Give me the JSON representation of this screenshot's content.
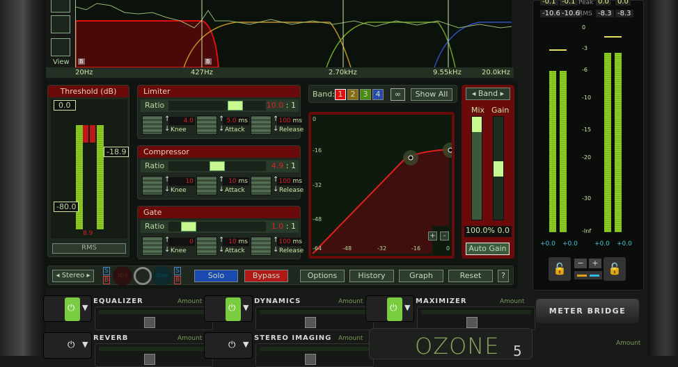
{
  "spectrum": {
    "view_label": "View",
    "freq_labels": [
      "20Hz",
      "427Hz",
      "2.70kHz",
      "9.55kHz",
      "20.0kHz"
    ],
    "band_marker": "B"
  },
  "threshold": {
    "title": "Threshold (dB)",
    "top": "0.0",
    "mid": "-18.9",
    "bottom": "-80.0",
    "readout": "8.9",
    "mode": "RMS"
  },
  "limiter": {
    "title": "Limiter",
    "ratio_label": "Ratio",
    "ratio": "10.0",
    "ratio_suffix": ": 1",
    "knee": "4.0",
    "attack": "5.0",
    "release": "100",
    "ms": "ms",
    "knee_label": "Knee",
    "attack_label": "Attack",
    "release_label": "Release",
    "ratio_pos": 0.72
  },
  "compressor": {
    "title": "Compressor",
    "ratio_label": "Ratio",
    "ratio": "4.9",
    "ratio_suffix": ": 1",
    "knee": "10",
    "attack": "10",
    "release": "100",
    "ms": "ms",
    "knee_label": "Knee",
    "attack_label": "Attack",
    "release_label": "Release",
    "ratio_pos": 0.5
  },
  "gate": {
    "title": "Gate",
    "ratio_label": "Ratio",
    "ratio": "1.0",
    "ratio_suffix": ": 1",
    "knee": "0",
    "attack": "10",
    "release": "100",
    "ms": "ms",
    "knee_label": "Knee",
    "attack_label": "Attack",
    "release_label": "Release",
    "ratio_pos": 0.15
  },
  "band": {
    "label": "Band:",
    "bands": [
      "1",
      "2",
      "3",
      "4"
    ],
    "band_colors": [
      "#dd1111",
      "#8a6a10",
      "#4a8a10",
      "#2a4aaa"
    ],
    "show_all": "Show All"
  },
  "graph": {
    "y_ticks": [
      "0",
      "-16",
      "-32",
      "-48"
    ],
    "x_ticks": [
      "-64",
      "-48",
      "-32",
      "-16",
      "0"
    ],
    "plus": "+",
    "minus": "-"
  },
  "mixgain": {
    "band_selector": "Band",
    "mix_label": "Mix",
    "gain_label": "Gain",
    "mix_value": "100.0%",
    "gain_value": "0.0",
    "auto_gain": "Auto Gain"
  },
  "toolbar": {
    "stereo": "Stereo",
    "s": "S",
    "b": "B",
    "mid": "Mid",
    "side": "Side",
    "solo": "Solo",
    "bypass": "Bypass",
    "options": "Options",
    "history": "History",
    "graph": "Graph",
    "reset": "Reset",
    "help": "?"
  },
  "modules": [
    {
      "name": "EQUALIZER",
      "amount": "Amount",
      "on": true
    },
    {
      "name": "DYNAMICS",
      "amount": "Amount",
      "on": true
    },
    {
      "name": "MAXIMIZER",
      "amount": "Amount",
      "on": true
    },
    {
      "name": "REVERB",
      "amount": "Amount",
      "on": false
    },
    {
      "name": "STEREO IMAGING",
      "amount": "Amount",
      "on": false
    }
  ],
  "meters": {
    "peak_label": "Peak",
    "rms_label": "RMS",
    "in_peak": [
      "-0.1",
      "-0.1"
    ],
    "out_peak": [
      "0.0",
      "0.0"
    ],
    "in_rms": [
      "-10.6",
      "-10.6"
    ],
    "out_rms": [
      "-8.3",
      "-8.3"
    ],
    "scale": [
      "0",
      "-3",
      "-6",
      "-10",
      "-15",
      "-20",
      "-30",
      "-Inf"
    ],
    "offsets": [
      "+0.0",
      "+0.0",
      "+0.0",
      "+0.0"
    ],
    "meter_bridge": "METER BRIDGE",
    "amount": "Amount"
  },
  "logo": "OZONE 5"
}
